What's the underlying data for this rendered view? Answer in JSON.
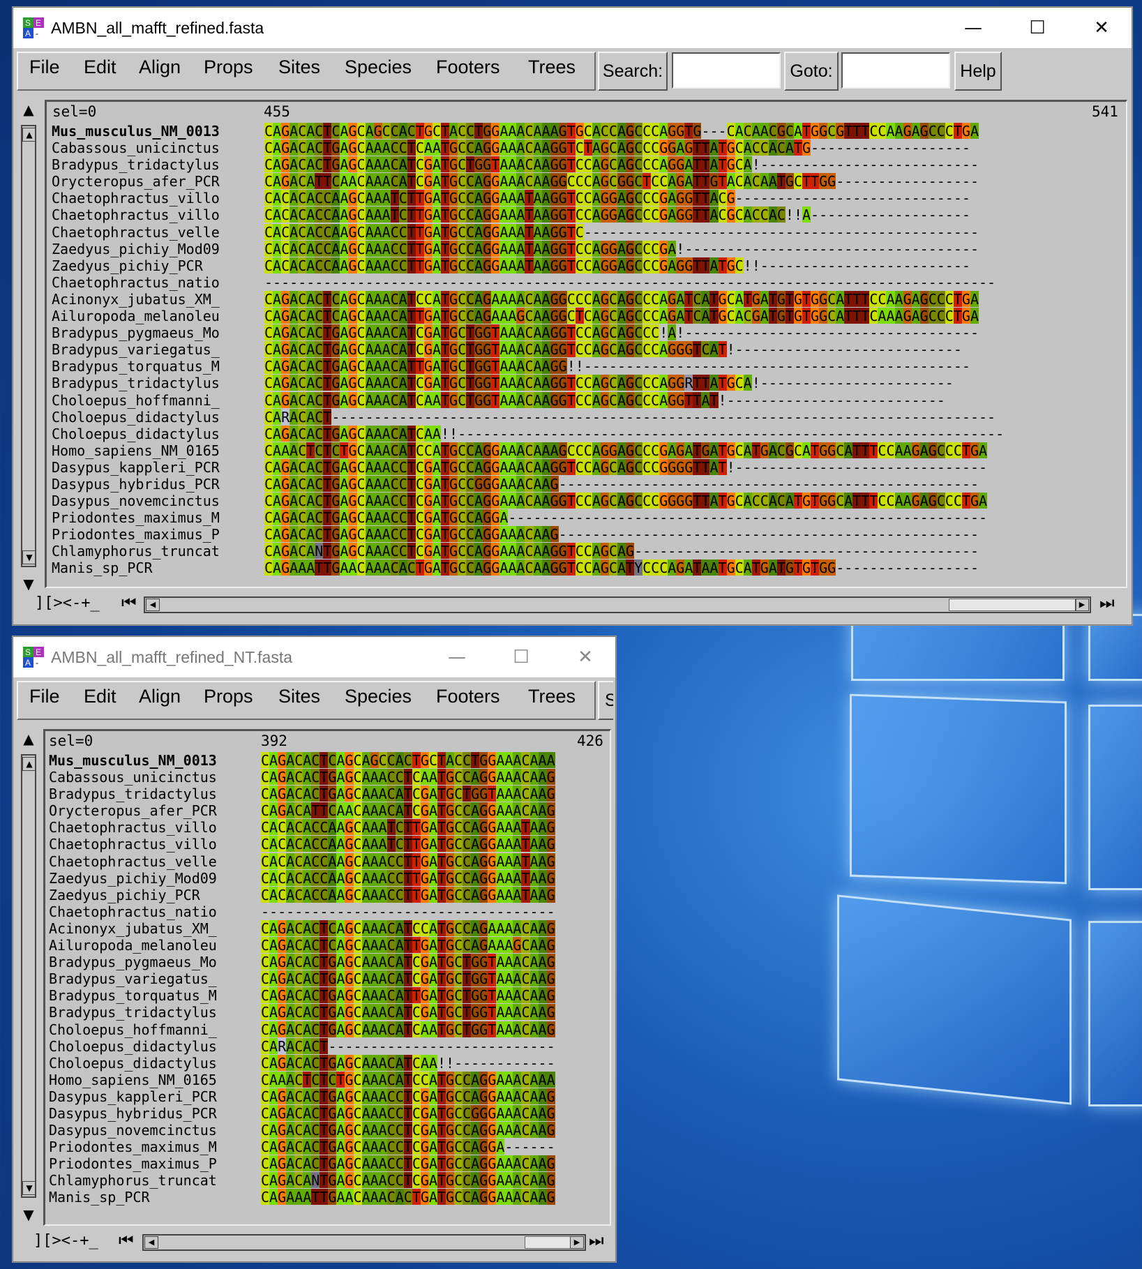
{
  "desktop": {
    "background": "#1a5db9"
  },
  "colors": {
    "A": "#7ddc00",
    "C": "#c9e000",
    "G": "#ff7a00",
    "T": "#d02000",
    "accent_dark": "#7a4000"
  },
  "window1": {
    "title": "AMBN_all_mafft_refined.fasta",
    "menu": [
      "File",
      "Edit",
      "Align",
      "Props",
      "Sites",
      "Species",
      "Footers",
      "Trees"
    ],
    "search_label": "Search:",
    "search_value": "",
    "goto_label": "Goto:",
    "goto_value": "",
    "help_label": "Help",
    "sel": "sel=0",
    "pos_start": "455",
    "pos_end": "541",
    "bottom_label": "][><-+_",
    "rows": [
      {
        "name": "Mus_musculus_NM_0013",
        "seq": "CAGACACTCAGCAGCCACTGCTACCTGGAAACAAAGTGCACCAGCCCAGGTG---CACAACGCATGGCGTTTCCAAGAGCCCTGA"
      },
      {
        "name": "Cabassous_unicinctus",
        "seq": "CAGACACTGAGCAAACCTCAATGCCAGGAAACAAGGTCTAGCAGCCCGGAGTTATGCACCACATG-------------------"
      },
      {
        "name": "Bradypus_tridactylus",
        "seq": "CAGACACTGAGCAAACATCGATGCTGGTAAACAAGGTCCAGCAGCCCAGGATTATGCA!--------------------------"
      },
      {
        "name": "Orycteropus_afer_PCR",
        "seq": "CAGACATTCAACAAACATCGATGCCAGGAAACAAGGCCCAGCGGCTCCAGATTGTACACAATGCTTGG-----------------"
      },
      {
        "name": "Chaetophractus_villo",
        "seq": "CACACACCAAGCAAATCTTGATGCCAGGAAATAAGGTCCAGGAGCCCGAGGTTACG----------------------------"
      },
      {
        "name": "Chaetophractus_villo",
        "seq": "CACACACCAAGCAAATCTTGATGCCAGGAAATAAGGTCCAGGAGCCCGAGGTTACGCACCAC!!A-------------------"
      },
      {
        "name": "Chaetophractus_velle",
        "seq": "CACACACCAAGCAAACCTTGATGCCAGGAAATAAGGTC-----------------------------------------------"
      },
      {
        "name": "Zaedyus_pichiy_Mod09",
        "seq": "CACACACCAAGCAAACCTTGATGCCAGGAAATAAGGTCCAGGAGCCCGA!-----------------------------------"
      },
      {
        "name": "Zaedyus_pichiy_PCR",
        "seq": "CACACACCAAGCAAACCTTGATGCCAGGAAATAAGGTCCAGGAGCCCGAGGTTATGC!!-------------------------"
      },
      {
        "name": "Chaetophractus_natio",
        "seq": "---------------------------------------------------------------------------------------"
      },
      {
        "name": "Acinonyx_jubatus_XM_",
        "seq": "CAGACACTCAGCAAACATCCATGCCAGAAAACAAGGCCCAGCAGCCCAGATCATGCATGATGTGTGGCATTTCCAAGAGCCCTGA"
      },
      {
        "name": "Ailuropoda_melanoleu",
        "seq": "CAGACACTCAGCAAACATTGATGCCAGAAAGCAAGGCTCAGCAGCCCAGATCATGCACGATGTGTGGCATTTCAAAGAGCCCTGA"
      },
      {
        "name": "Bradypus_pygmaeus_Mo",
        "seq": "CAGACACTGAGCAAACATCGATGCTGGTAAACAAGGTCCAGCAGCCC!A!-----------------------------------"
      },
      {
        "name": "Bradypus_variegatus_",
        "seq": "CAGACACTGAGCAAACATCGATGCTGGTAAACAAGGTCCAGCAGCCCAGGGTCAT!---------------------------"
      },
      {
        "name": "Bradypus_torquatus_M",
        "seq": "CAGACACTGAGCAAACATTGATGCTGGTAAACAAGG!!----------------------------------------------"
      },
      {
        "name": "Bradypus_tridactylus",
        "seq": "CAGACACTGAGCAAACATCGATGCTGGTAAACAAGGTCCAGCAGCCCAGGRTTATGCA!-----------------------"
      },
      {
        "name": "Choloepus_hoffmanni_",
        "seq": "CAGACACTGAGCAAACATCAATGCTGGTAAACAAGGTCCAGCAGCCCAGGTTAT!--------------------------"
      },
      {
        "name": "Choloepus_didactylus",
        "seq": "CARACACT-------------------------------------------------------------------------------"
      },
      {
        "name": "Choloepus_didactylus",
        "seq": "CAGACACTGAGCAAACATCAA!!-----------------------------------------------------------------"
      },
      {
        "name": "Homo_sapiens_NM_0165",
        "seq": "CAAACTCTCTGCAAACATCCATGCCAGGAAACAAAGCCCAGGAGCCCGAGATGATGCATGACGCATGGCATTTCCAAGAGCCCTGA"
      },
      {
        "name": "Dasypus_kappleri_PCR",
        "seq": "CAGACACTGAGCAAACCTCGATGCCAGGAAACAAGGTCCAGCAGCCCGGGGTTAT!------------------------------"
      },
      {
        "name": "Dasypus_hybridus_PCR",
        "seq": "CAGACACTGAGCAAACCTCGATGCCGGGAAACAAG--------------------------------------------------"
      },
      {
        "name": "Dasypus_novemcinctus",
        "seq": "CAGACACTGAGCAAACCTCGATGCCAGGAAACAAGGTCCAGCAGCCCGGGGTTATGCACCACATGTGGCATTTCCAAGAGCCCTGA"
      },
      {
        "name": "Priodontes_maximus_M",
        "seq": "CAGACACTGAGCAAACCTCGATGCCAGGA---------------------------------------------------------"
      },
      {
        "name": "Priodontes_maximus_P",
        "seq": "CAGACACTGAGCAAACCTCGATGCCAGGAAACAAG--------------------------------------------------"
      },
      {
        "name": "Chlamyphorus_truncat",
        "seq": "CAGACANTGAGCAAACCTCGATGCCAGGAAACAAGGTCCAGCAG-----------------------------------------"
      },
      {
        "name": "Manis_sp_PCR",
        "seq": "CAGAAATTGAACAAACACTGATGCCAGGAAACAAGGTCCAGCATYCCCAGATAATGCATGATGTGTGG-----------------"
      }
    ]
  },
  "window2": {
    "title": "AMBN_all_mafft_refined_NT.fasta",
    "menu": [
      "File",
      "Edit",
      "Align",
      "Props",
      "Sites",
      "Species",
      "Footers",
      "Trees",
      "Se"
    ],
    "sel": "sel=0",
    "pos_start": "392",
    "pos_end": "426",
    "bottom_label": "][><-+_",
    "rows": [
      {
        "name": "Mus_musculus_NM_0013",
        "seq": "CAGACACTCAGCAGCCACTGCTACCTGGAAACAAA"
      },
      {
        "name": "Cabassous_unicinctus",
        "seq": "CAGACACTGAGCAAACCTCAATGCCAGGAAACAAG"
      },
      {
        "name": "Bradypus_tridactylus",
        "seq": "CAGACACTGAGCAAACATCGATGCTGGTAAACAAG"
      },
      {
        "name": "Orycteropus_afer_PCR",
        "seq": "CAGACATTCAACAAACATCGATGCCAGGAAACAAG"
      },
      {
        "name": "Chaetophractus_villo",
        "seq": "CACACACCAAGCAAATCTTGATGCCAGGAAATAAG"
      },
      {
        "name": "Chaetophractus_villo",
        "seq": "CACACACCAAGCAAATCTTGATGCCAGGAAATAAG"
      },
      {
        "name": "Chaetophractus_velle",
        "seq": "CACACACCAAGCAAACCTTGATGCCAGGAAATAAG"
      },
      {
        "name": "Zaedyus_pichiy_Mod09",
        "seq": "CACACACCAAGCAAACCTTGATGCCAGGAAATAAG"
      },
      {
        "name": "Zaedyus_pichiy_PCR",
        "seq": "CACACACCAAGCAAACCTTGATGCCAGGAAATAAG"
      },
      {
        "name": "Chaetophractus_natio",
        "seq": "-----------------------------------"
      },
      {
        "name": "Acinonyx_jubatus_XM_",
        "seq": "CAGACACTCAGCAAACATCCATGCCAGAAAACAAG"
      },
      {
        "name": "Ailuropoda_melanoleu",
        "seq": "CAGACACTCAGCAAACATTGATGCCAGAAAGCAAG"
      },
      {
        "name": "Bradypus_pygmaeus_Mo",
        "seq": "CAGACACTGAGCAAACATCGATGCTGGTAAACAAG"
      },
      {
        "name": "Bradypus_variegatus_",
        "seq": "CAGACACTGAGCAAACATCGATGCTGGTAAACAAG"
      },
      {
        "name": "Bradypus_torquatus_M",
        "seq": "CAGACACTGAGCAAACATTGATGCTGGTAAACAAG"
      },
      {
        "name": "Bradypus_tridactylus",
        "seq": "CAGACACTGAGCAAACATCGATGCTGGTAAACAAG"
      },
      {
        "name": "Choloepus_hoffmanni_",
        "seq": "CAGACACTGAGCAAACATCAATGCTGGTAAACAAG"
      },
      {
        "name": "Choloepus_didactylus",
        "seq": "CARACACT---------------------------"
      },
      {
        "name": "Choloepus_didactylus",
        "seq": "CAGACACTGAGCAAACATCAA!!------------"
      },
      {
        "name": "Homo_sapiens_NM_0165",
        "seq": "CAAACTCTCTGCAAACATCCATGCCAGGAAACAAA"
      },
      {
        "name": "Dasypus_kappleri_PCR",
        "seq": "CAGACACTGAGCAAACCTCGATGCCAGGAAACAAG"
      },
      {
        "name": "Dasypus_hybridus_PCR",
        "seq": "CAGACACTGAGCAAACCTCGATGCCGGGAAACAAG"
      },
      {
        "name": "Dasypus_novemcinctus",
        "seq": "CAGACACTGAGCAAACCTCGATGCCAGGAAACAAG"
      },
      {
        "name": "Priodontes_maximus_M",
        "seq": "CAGACACTGAGCAAACCTCGATGCCAGGA------"
      },
      {
        "name": "Priodontes_maximus_P",
        "seq": "CAGACACTGAGCAAACCTCGATGCCAGGAAACAAG"
      },
      {
        "name": "Chlamyphorus_truncat",
        "seq": "CAGACANTGAGCAAACCTCGATGCCAGGAAACAAG"
      },
      {
        "name": "Manis_sp_PCR",
        "seq": "CAGAAATTGAACAAACACTGATGCCAGGAAACAAG"
      }
    ]
  }
}
